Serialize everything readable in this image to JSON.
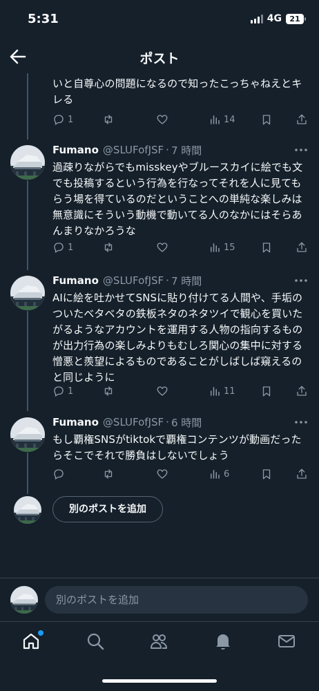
{
  "status_bar": {
    "time": "5:31",
    "network": "4G",
    "battery": "21"
  },
  "header": {
    "title": "ポスト"
  },
  "posts": [
    {
      "text": "いと自尊心の問題になるので知ったこっちゃねえとキレる",
      "replies": "1",
      "reposts": "",
      "likes": "",
      "views": "14"
    },
    {
      "name": "Fumano",
      "handle": "@SLUFofJSF",
      "separator": "·",
      "time": "7 時間",
      "text": "過疎りながらでもmisskeyやブルースカイに絵でも文でも投稿するという行為を行なってそれを人に見てもらう場を得ているのだということへの単純な楽しみは無意識にそういう動機で動いてる人のなかにはそらあんまりなかろうな",
      "replies": "1",
      "reposts": "",
      "likes": "",
      "views": "15"
    },
    {
      "name": "Fumano",
      "handle": "@SLUFofJSF",
      "separator": "·",
      "time": "7 時間",
      "text": "AIに絵を吐かせてSNSに貼り付けてる人間や、手垢のついたベタベタの鉄板ネタのネタツイで観心を買いたがるようなアカウントを運用する人物の指向するものが出力行為の楽しみよりもむしろ関心の集中に対する憎悪と羨望によるものであることがしばしば窺えるのと同じように",
      "replies": "1",
      "reposts": "",
      "likes": "",
      "views": "11"
    },
    {
      "name": "Fumano",
      "handle": "@SLUFofJSF",
      "separator": "·",
      "time": "6 時間",
      "text": "もし覇権SNSがtiktokで覇権コンテンツが動画だったらそこでそれで勝負はしないでしょう",
      "replies": "",
      "reposts": "",
      "likes": "",
      "views": "6"
    }
  ],
  "add_post_button": "別のポストを追加",
  "compose": {
    "placeholder": "別のポストを追加"
  },
  "icons": {
    "back": "arrow-left-icon",
    "more": "more-horizontal-icon",
    "reply": "reply-icon",
    "repost": "repost-icon",
    "like": "heart-icon",
    "views": "views-icon",
    "bookmark": "bookmark-icon",
    "share": "share-icon",
    "tabs": [
      "home-icon",
      "search-icon",
      "communities-icon",
      "notifications-icon",
      "messages-icon"
    ]
  },
  "colors": {
    "background": "#15202b",
    "accent": "#1d9bf0",
    "muted": "#8b98a5"
  }
}
